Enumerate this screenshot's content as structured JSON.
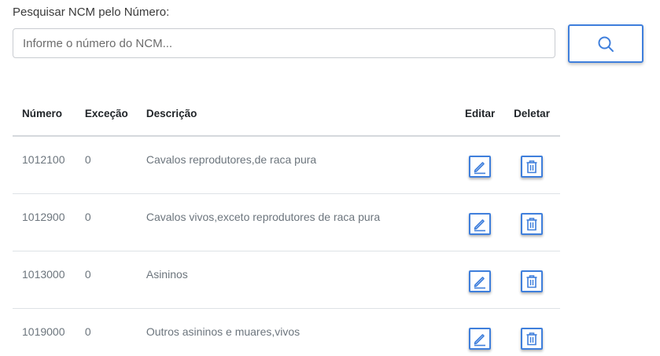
{
  "search": {
    "label": "Pesquisar NCM pelo Número:",
    "placeholder": "Informe o número do NCM...",
    "value": "",
    "button_icon": "search-icon",
    "accent_color": "#3f7fdc"
  },
  "table": {
    "headers": {
      "numero": "Número",
      "excecao": "Exceção",
      "descricao": "Descrição",
      "editar": "Editar",
      "deletar": "Deletar"
    },
    "rows": [
      {
        "numero": "1012100",
        "excecao": "0",
        "descricao": "Cavalos reprodutores,de raca pura",
        "edit_icon": "edit-icon",
        "delete_icon": "trash-icon"
      },
      {
        "numero": "1012900",
        "excecao": "0",
        "descricao": "Cavalos vivos,exceto reprodutores de raca pura",
        "edit_icon": "edit-icon",
        "delete_icon": "trash-icon"
      },
      {
        "numero": "1013000",
        "excecao": "0",
        "descricao": "Asininos",
        "edit_icon": "edit-icon",
        "delete_icon": "trash-icon"
      },
      {
        "numero": "1019000",
        "excecao": "0",
        "descricao": "Outros asininos e muares,vivos",
        "edit_icon": "edit-icon",
        "delete_icon": "trash-icon"
      }
    ]
  }
}
